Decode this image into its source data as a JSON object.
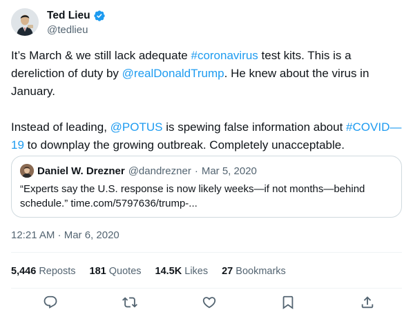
{
  "author": {
    "display_name": "Ted Lieu",
    "handle": "@tedlieu",
    "verified": true
  },
  "tweet": {
    "paragraph1": [
      {
        "text": "It’s March & we still lack adequate ",
        "link": false
      },
      {
        "text": "#coronavirus",
        "link": true
      },
      {
        "text": " test kits. This is a dereliction of duty by ",
        "link": false
      },
      {
        "text": "@realDonaldTrump",
        "link": true
      },
      {
        "text": ". He knew about the virus in January.",
        "link": false
      }
    ],
    "paragraph2": [
      {
        "text": "Instead of leading, ",
        "link": false
      },
      {
        "text": "@POTUS",
        "link": true
      },
      {
        "text": " is spewing false information about ",
        "link": false
      },
      {
        "text": "#COVID—19",
        "link": true
      },
      {
        "text": " to downplay the growing outbreak. Completely unacceptable.",
        "link": false
      }
    ]
  },
  "quote": {
    "display_name": "Daniel W. Drezner",
    "handle": "@dandrezner",
    "separator": "·",
    "date": "Mar 5, 2020",
    "text_line1": "“Experts say the U.S. response is now likely weeks—if not months—behind",
    "text_line2": "schedule.” time.com/5797636/trump-..."
  },
  "timestamp": "12:21 AM · Mar 6, 2020",
  "stats": {
    "reposts_count": "5,446",
    "reposts_label": "Reposts",
    "quotes_count": "181",
    "quotes_label": "Quotes",
    "likes_count": "14.5K",
    "likes_label": "Likes",
    "bookmarks_count": "27",
    "bookmarks_label": "Bookmarks"
  },
  "icons": {
    "verified": "verified-badge-icon",
    "reply": "reply-icon",
    "repost": "repost-icon",
    "like": "heart-icon",
    "bookmark": "bookmark-icon",
    "share": "share-icon"
  },
  "colors": {
    "link": "#1d9bf0",
    "secondary_text": "#536471",
    "border": "#cfd9de"
  }
}
